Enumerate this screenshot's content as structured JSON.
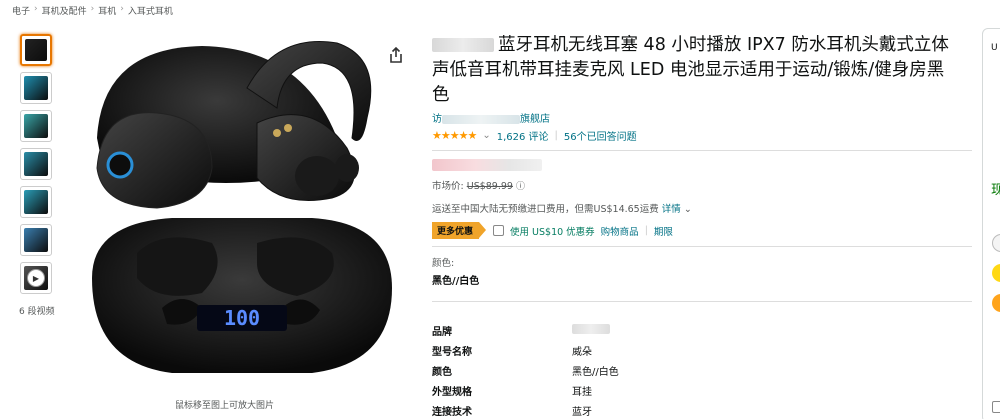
{
  "breadcrumb": [
    "电子",
    "耳机及配件",
    "耳机",
    "入耳式耳机"
  ],
  "breadcrumb_sep": "›",
  "thumbnails": [
    {
      "name": "thumb-earbuds-case",
      "color": "#222"
    },
    {
      "name": "thumb-features",
      "color": "#1f8fb0"
    },
    {
      "name": "thumb-model",
      "color": "#3aa6a8"
    },
    {
      "name": "thumb-battery",
      "color": "#2a8ea8"
    },
    {
      "name": "thumb-case-detail",
      "color": "#2b9db7"
    },
    {
      "name": "thumb-phone-pairing",
      "color": "#3a7fb0"
    },
    {
      "name": "thumb-video",
      "color": "#555"
    }
  ],
  "video_label": "6 段视频",
  "hover_hint": "鼠标移至图上可放大图片",
  "product": {
    "title": "蓝牙耳机无线耳塞 48 小时播放 IPX7 防水耳机头戴式立体声低音耳机带耳挂麦克风 LED 电池显示适用于运动/锻炼/健身房黑色",
    "store_prefix": "访",
    "store_suffix": "旗舰店",
    "stars": "★★★★★",
    "rating_chevron": "⌄",
    "review_count": "1,626 评论",
    "qa_count": "56个已回答问题",
    "list_price_label": "市场价:",
    "list_price": "US$89.99",
    "shipping_text": "运送至中国大陆无预缴进口费用，但需US$14.65运费",
    "shipping_details": "详情",
    "deal_badge": "更多优惠",
    "coupon_text": "使用 US$10 优惠券",
    "coupon_link1": "购物商品",
    "coupon_link2": "期限",
    "color_label": "颜色:",
    "color_value": "黑色//白色"
  },
  "specs": [
    {
      "key": "品牌",
      "value": ""
    },
    {
      "key": "型号名称",
      "value": "威朵"
    },
    {
      "key": "颜色",
      "value": "黑色//白色"
    },
    {
      "key": "外型规格",
      "value": "耳挂"
    },
    {
      "key": "连接技术",
      "value": "蓝牙"
    }
  ],
  "earbud_display": "100",
  "buybox": {
    "top_text": "U",
    "green_text": "现"
  },
  "colors": {
    "accent": "#e77600",
    "link": "#007185",
    "star": "#ff9900",
    "deal": "#f0a42a",
    "coupon_green": "#067d62"
  }
}
